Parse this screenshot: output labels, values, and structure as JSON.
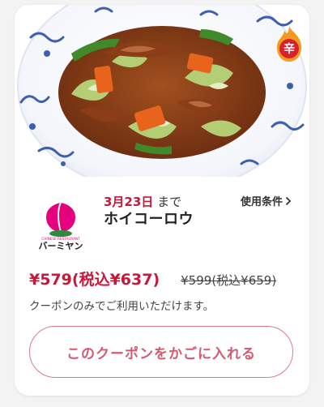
{
  "coupon": {
    "date": "3月23日",
    "date_suffix": "まで",
    "title": "ホイコーロウ",
    "conditions_label": "使用条件",
    "price_now": "¥579(税込¥637)",
    "price_old": "¥599(税込¥659)",
    "note": "クーポンのみでご利用いただけます。",
    "add_button_label": "このクーポンをかごに入れる",
    "spicy_badge": "辛"
  },
  "brand": {
    "logo_small_text": "CHINESE RESTAURANT",
    "logo_name": "バーミヤン"
  },
  "colors": {
    "accent": "#c8183a",
    "button_border": "#e07a8c",
    "button_text": "#d35a70",
    "logo_pink": "#e6007e",
    "logo_green": "#2e8b3d",
    "badge_orange": "#f39a1e"
  }
}
